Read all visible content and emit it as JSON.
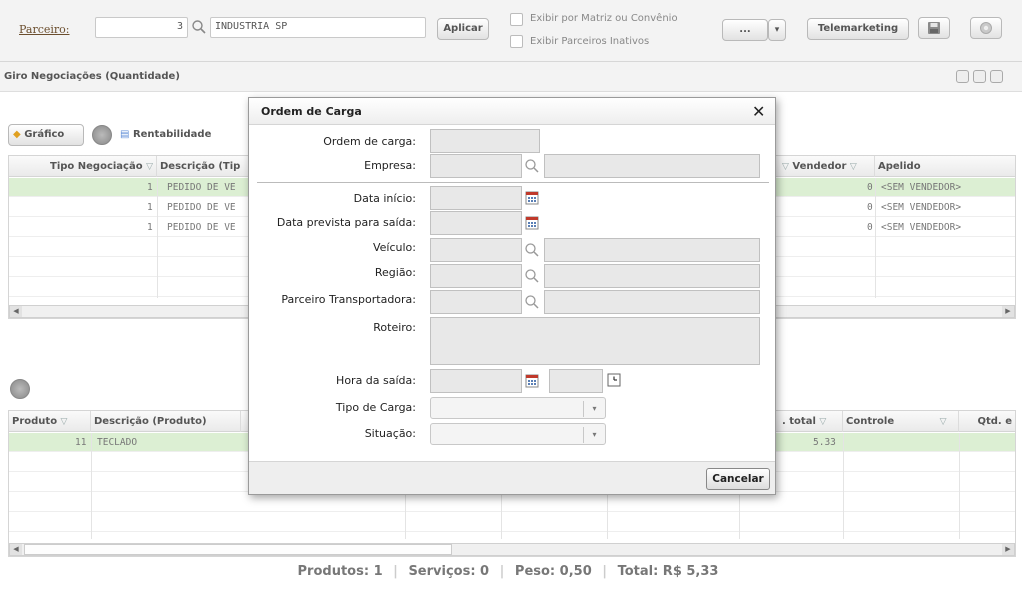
{
  "toolbar": {
    "parceiro_label": "Parceiro:",
    "parceiro_code": "3",
    "parceiro_name": "INDUSTRIA SP",
    "aplicar": "Aplicar",
    "chk_matriz": "Exibir por Matriz ou Convênio",
    "chk_inativos": "Exibir Parceiros Inativos",
    "more": "...",
    "dropdown_arrow": "▾",
    "telemarketing": "Telemarketing",
    "save_icon": "save-icon",
    "settings_icon": "gear-icon"
  },
  "giro": {
    "title": "Giro Negociações (Quantidade)",
    "grafico": "Gráfico",
    "rentabilidade": "Rentabilidade",
    "columns": {
      "tipo": "Tipo Negociação",
      "descricao": "Descrição (Tip",
      "vendedor": "Vendedor",
      "apelido": "Apelido"
    },
    "rows": [
      {
        "tipo": "1",
        "descricao": "PEDIDO DE VE",
        "vendedor": "0",
        "apelido": "<SEM VENDEDOR>"
      },
      {
        "tipo": "1",
        "descricao": "PEDIDO DE VE",
        "vendedor": "0",
        "apelido": "<SEM VENDEDOR>"
      },
      {
        "tipo": "1",
        "descricao": "PEDIDO DE VE",
        "vendedor": "0",
        "apelido": "<SEM VENDEDOR>"
      }
    ]
  },
  "produtos": {
    "columns": {
      "produto": "Produto",
      "descricao": "Descrição (Produto)",
      "vtotal": ". total",
      "controle": "Controle",
      "qtd": "Qtd. e"
    },
    "rows": [
      {
        "produto": "11",
        "descricao": "TECLADO",
        "vtotal": "5.33"
      }
    ]
  },
  "footer": {
    "produtos": "Produtos: 1",
    "servicos": "Serviços: 0",
    "peso": "Peso: 0,50",
    "total": "Total: R$ 5,33"
  },
  "dialog": {
    "title": "Ordem de Carga",
    "close": "✕",
    "fields": {
      "ordem": "Ordem de carga:",
      "empresa": "Empresa:",
      "data_inicio": "Data início:",
      "data_prevista": "Data prevista para saída:",
      "veiculo": "Veículo:",
      "regiao": "Região:",
      "parceiro": "Parceiro Transportadora:",
      "roteiro": "Roteiro:",
      "hora": "Hora da saída:",
      "tipo_carga": "Tipo de Carga:",
      "situacao": "Situação:"
    },
    "cancel": "Cancelar"
  }
}
